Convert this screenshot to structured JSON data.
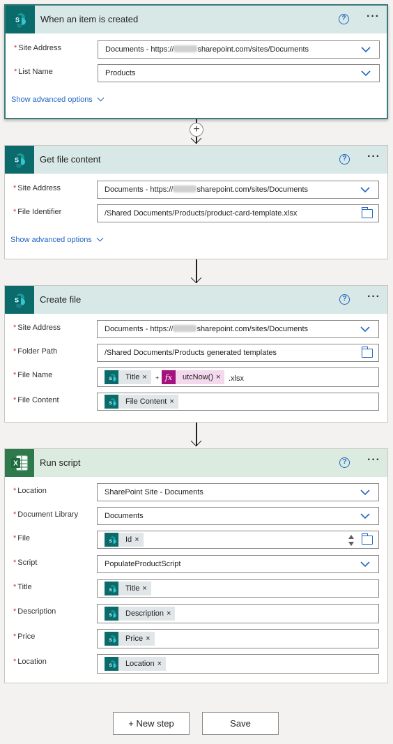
{
  "steps": [
    {
      "title": "When an item is created",
      "fields": [
        {
          "label": "Site Address",
          "value_prefix": "Documents - https://",
          "value_suffix": "sharepoint.com/sites/Documents"
        },
        {
          "label": "List Name",
          "value": "Products"
        }
      ],
      "advanced_label": "Show advanced options"
    },
    {
      "title": "Get file content",
      "fields": [
        {
          "label": "Site Address",
          "value_prefix": "Documents - https://",
          "value_suffix": "sharepoint.com/sites/Documents"
        },
        {
          "label": "File Identifier",
          "value": "/Shared Documents/Products/product-card-template.xlsx"
        }
      ],
      "advanced_label": "Show advanced options"
    },
    {
      "title": "Create file",
      "fields": [
        {
          "label": "Site Address",
          "value_prefix": "Documents - https://",
          "value_suffix": "sharepoint.com/sites/Documents"
        },
        {
          "label": "Folder Path",
          "value": "/Shared Documents/Products generated templates"
        },
        {
          "label": "File Name",
          "tokens": [
            "Title",
            "+",
            "utcNow()",
            ".xlsx"
          ]
        },
        {
          "label": "File Content",
          "tokens": [
            "File Content"
          ]
        }
      ]
    },
    {
      "title": "Run script",
      "fields": [
        {
          "label": "Location",
          "value": "SharePoint Site - Documents"
        },
        {
          "label": "Document Library",
          "value": "Documents"
        },
        {
          "label": "File",
          "tokens": [
            "Id"
          ]
        },
        {
          "label": "Script",
          "value": "PopulateProductScript"
        },
        {
          "label": "Title",
          "tokens": [
            "Title"
          ]
        },
        {
          "label": "Description",
          "tokens": [
            "Description"
          ]
        },
        {
          "label": "Price",
          "tokens": [
            "Price"
          ]
        },
        {
          "label": "Location",
          "tokens": [
            "Location"
          ]
        }
      ]
    }
  ],
  "icons": {
    "sharepoint": "sharepoint-icon",
    "excel": "excel-icon",
    "help": "help-icon",
    "more": "more-options-icon",
    "chevron": "chevron-down-icon",
    "folder": "folder-icon",
    "fx": "expression-icon",
    "close": "remove-token-icon"
  },
  "glyphs": {
    "help": "?",
    "more": "···",
    "remove": "×",
    "fx": "fx",
    "required": "*",
    "add": "+"
  },
  "buttons": {
    "new_step": "+ New step",
    "save": "Save"
  },
  "colors": {
    "accent": "#2266c3",
    "sharepoint": "#0b6a6a",
    "excel": "#2e7a4d",
    "expression": "#a3127e",
    "required": "#c4314b"
  }
}
